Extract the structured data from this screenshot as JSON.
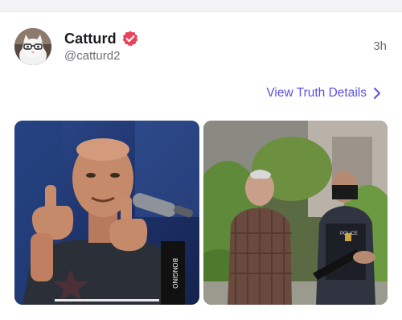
{
  "post": {
    "author": {
      "display_name": "Catturd",
      "handle": "@catturd2",
      "verified": true,
      "avatar_icon": "cat-avatar"
    },
    "timestamp": "3h",
    "details_link": {
      "label": "View Truth Details",
      "icon": "chevron-right-icon"
    },
    "media": [
      {
        "description_icon": "studio-host-photo"
      },
      {
        "description_icon": "arrest-scene-photo"
      }
    ]
  },
  "colors": {
    "accent": "#5b4fe0",
    "verified_badge": "#e8435a",
    "text_primary": "#1b1b22",
    "text_secondary": "#6e6e7a",
    "background": "#f3f3f5",
    "card": "#ffffff"
  }
}
